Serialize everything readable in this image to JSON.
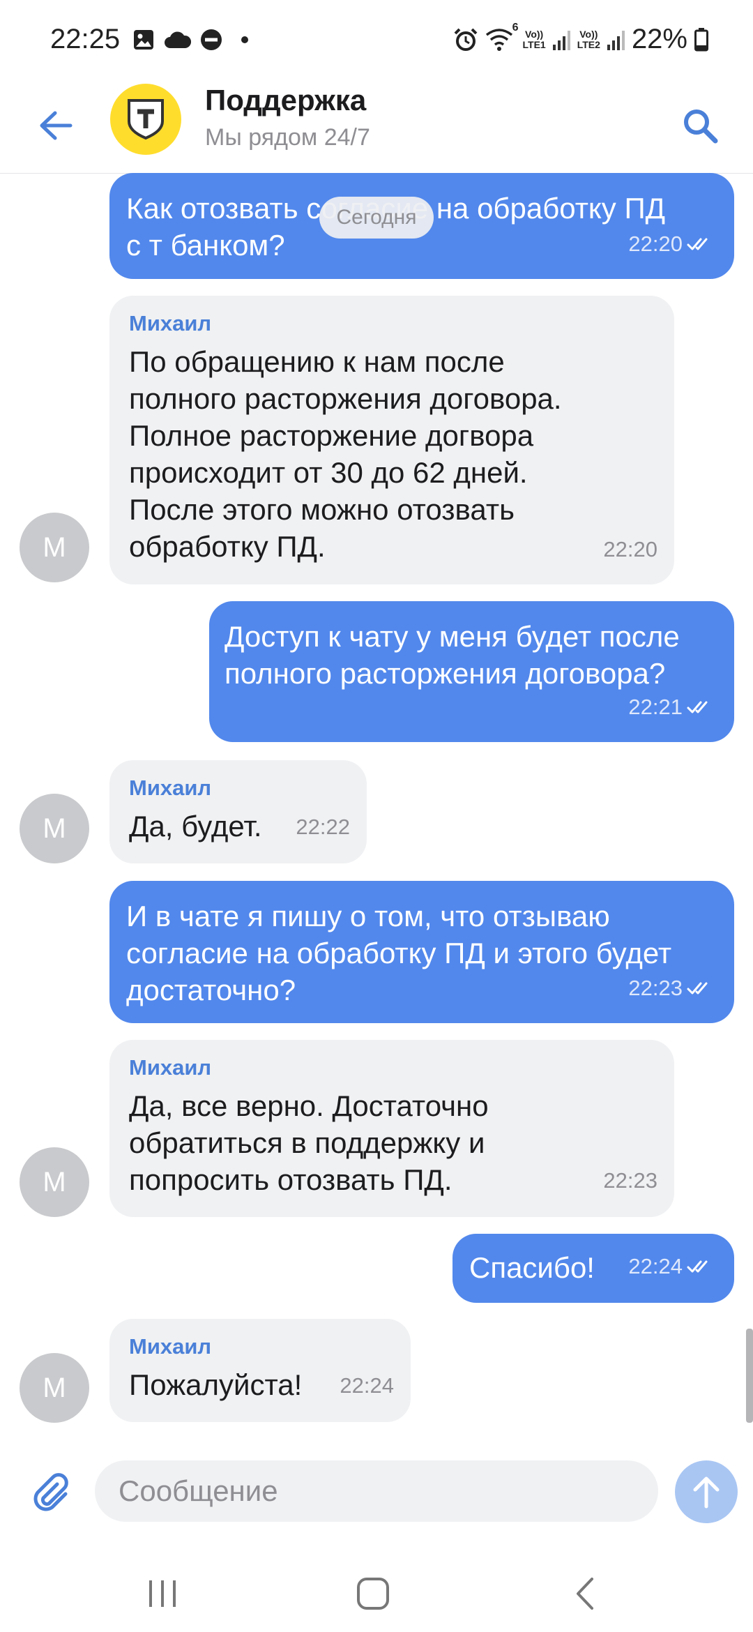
{
  "status_bar": {
    "time": "22:25",
    "wifi_badge": "6",
    "sim1_top": "Vo))",
    "sim1_bottom": "LTE1",
    "sim2_top": "Vo))",
    "sim2_bottom": "LTE2",
    "battery": "22%"
  },
  "header": {
    "title": "Поддержка",
    "subtitle": "Мы рядом 24/7",
    "logo_colors": {
      "background": "#ffdd2d",
      "shield": "#333333"
    }
  },
  "date_chip": "Сегодня",
  "messages": [
    {
      "direction": "out",
      "lines": [
        "Как отозвать согласие на обработку ПД",
        "с т банком?"
      ],
      "time": "22:20",
      "status": "read"
    },
    {
      "direction": "in",
      "sender": "Михаил",
      "avatar_initial": "М",
      "lines": [
        "По обращению к нам после",
        "полного расторжения договора.",
        "Полное расторжение догвора",
        "происходит от 30 до 62 дней.",
        "После этого можно отозвать",
        "обработку ПД."
      ],
      "time": "22:20"
    },
    {
      "direction": "out",
      "lines": [
        "Доступ к чату у меня будет после",
        "полного расторжения договора?"
      ],
      "time": "22:21",
      "status": "read"
    },
    {
      "direction": "in",
      "sender": "Михаил",
      "avatar_initial": "М",
      "lines": [
        "Да, будет."
      ],
      "time": "22:22"
    },
    {
      "direction": "out",
      "lines": [
        "И в чате я пишу о том, что отзываю",
        "согласие на обработку ПД и этого будет",
        "достаточно?"
      ],
      "time": "22:23",
      "status": "read"
    },
    {
      "direction": "in",
      "sender": "Михаил",
      "avatar_initial": "М",
      "lines": [
        "Да, все верно. Достаточно",
        "обратиться в поддержку и",
        "попросить отозвать ПД."
      ],
      "time": "22:23"
    },
    {
      "direction": "out",
      "lines": [
        "Спасибо!"
      ],
      "time": "22:24",
      "status": "read"
    },
    {
      "direction": "in",
      "sender": "Михаил",
      "avatar_initial": "М",
      "lines": [
        "Пожалуйста!"
      ],
      "time": "22:24"
    }
  ],
  "composer": {
    "placeholder": "Сообщение"
  },
  "colors": {
    "accent": "#4a80d8",
    "outgoing_bubble": "#5288ec",
    "incoming_bubble": "#f0f1f3",
    "send_button": "#a9c6f3"
  }
}
